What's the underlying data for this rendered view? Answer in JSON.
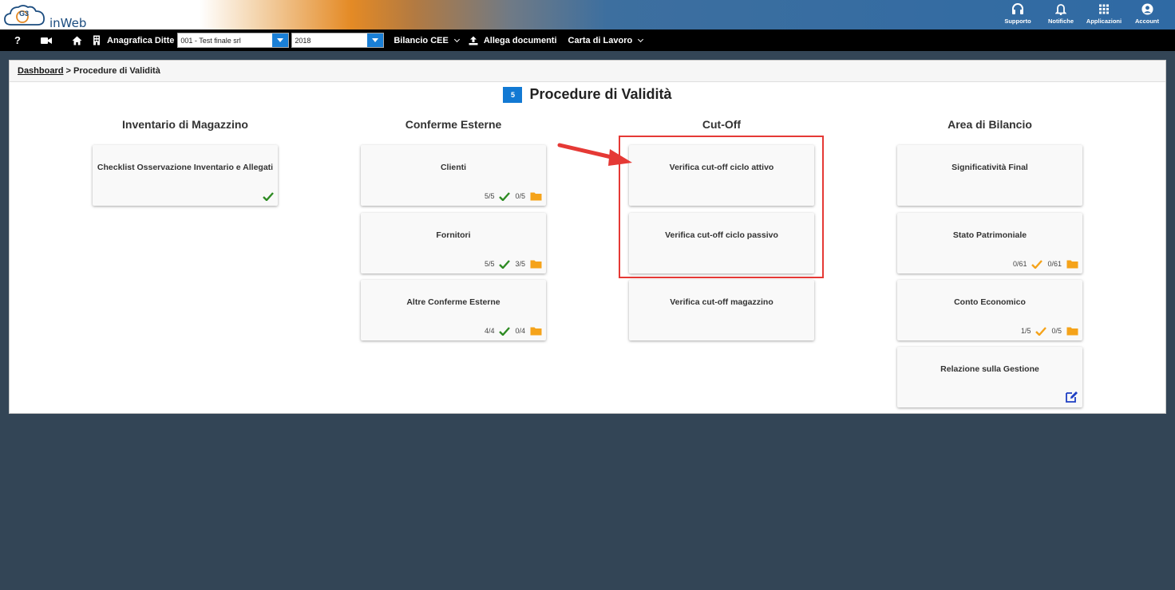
{
  "header": {
    "logo_text": "inWeb",
    "logo_mark": "G3",
    "actions": [
      {
        "label": "Supporto",
        "icon": "headset-icon"
      },
      {
        "label": "Notifiche",
        "icon": "bell-icon"
      },
      {
        "label": "Applicazioni",
        "icon": "grid-icon"
      },
      {
        "label": "Account",
        "icon": "user-icon"
      }
    ]
  },
  "toolbar": {
    "help_label": "?",
    "anagrafica_label": "Anagrafica Ditte",
    "company_value": "001 - Test finale srl",
    "year_value": "2018",
    "bilancio_label": "Bilancio CEE",
    "allega_label": "Allega documenti",
    "carta_label": "Carta di Lavoro"
  },
  "breadcrumb": {
    "root": "Dashboard",
    "separator": " > ",
    "current": "Procedure di Validità"
  },
  "page": {
    "count": "5",
    "title": "Procedure di Validità"
  },
  "columns": [
    {
      "title": "Inventario di Magazzino",
      "cards": [
        {
          "title": "Checklist Osservazione Inventario e Allegati",
          "status": "check-green"
        }
      ]
    },
    {
      "title": "Conferme Esterne",
      "cards": [
        {
          "title": "Clienti",
          "count_a": "5/5",
          "count_b": "0/5",
          "status": "check-green"
        },
        {
          "title": "Fornitori",
          "count_a": "5/5",
          "count_b": "3/5",
          "status": "check-green"
        },
        {
          "title": "Altre Conferme Esterne",
          "count_a": "4/4",
          "count_b": "0/4",
          "status": "check-green"
        }
      ]
    },
    {
      "title": "Cut-Off",
      "cards": [
        {
          "title": "Verifica cut-off ciclo attivo"
        },
        {
          "title": "Verifica cut-off ciclo passivo"
        },
        {
          "title": "Verifica cut-off magazzino"
        }
      ]
    },
    {
      "title": "Area di Bilancio",
      "cards": [
        {
          "title": "Significatività Final"
        },
        {
          "title": "Stato Patrimoniale",
          "count_a": "0/61",
          "count_b": "0/61",
          "status": "check-orange"
        },
        {
          "title": "Conto Economico",
          "count_a": "1/5",
          "count_b": "0/5",
          "status": "check-orange"
        },
        {
          "title": "Relazione sulla Gestione",
          "status": "edit-icon"
        }
      ]
    }
  ],
  "colors": {
    "accent_blue": "#1279d3",
    "check_green": "#2e8b23",
    "check_orange": "#f5a31a",
    "folder_orange": "#f5a31a",
    "highlight_red": "#e53935",
    "background": "#334556"
  }
}
